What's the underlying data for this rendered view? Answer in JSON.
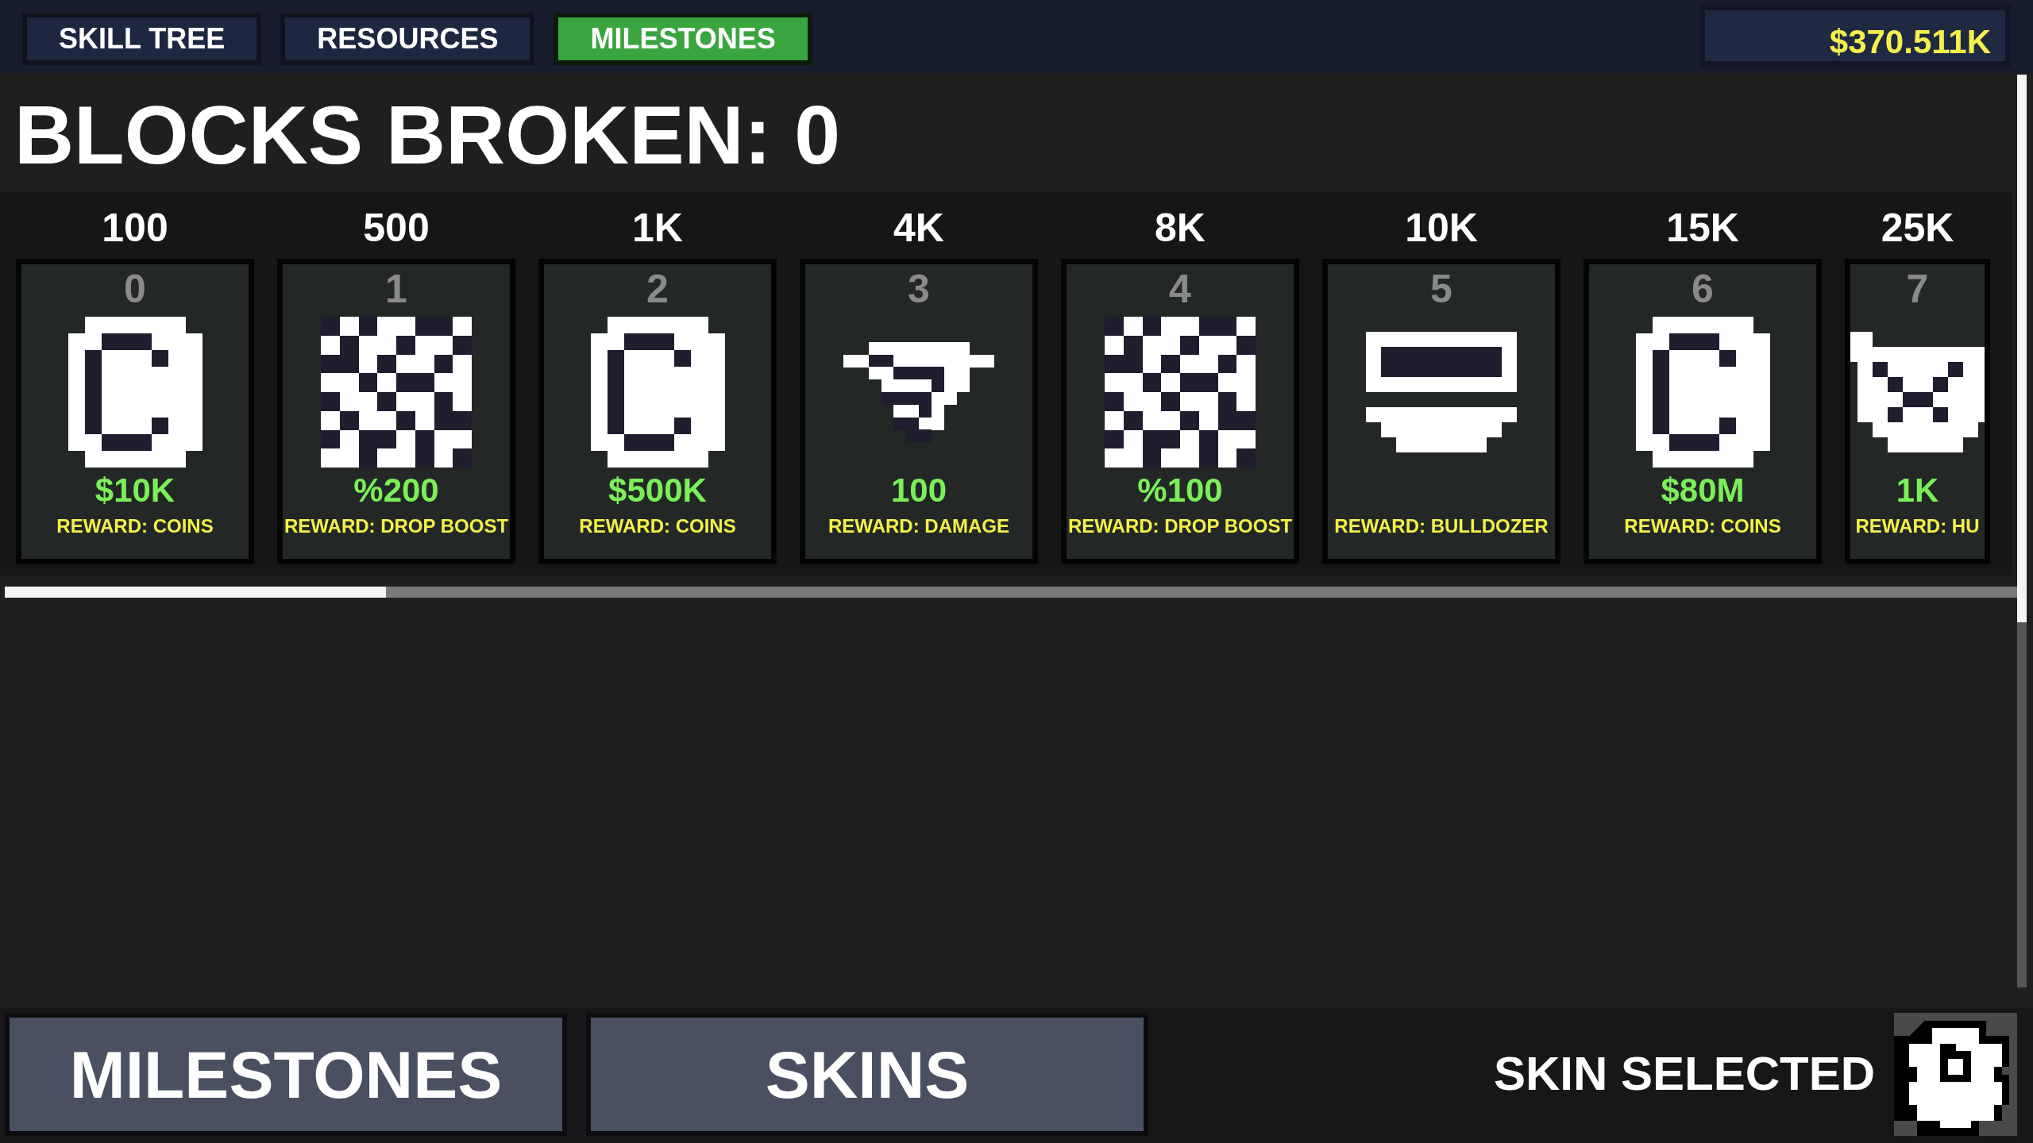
{
  "tabs": [
    {
      "label": "SKILL TREE",
      "selected": false
    },
    {
      "label": "RESOURCES",
      "selected": false
    },
    {
      "label": "MILESTONES",
      "selected": true
    }
  ],
  "balance": "$370.511K",
  "title": "BLOCKS BROKEN: 0",
  "milestones": [
    {
      "threshold": "100",
      "index": "0",
      "kind": "coin",
      "value": "$10K",
      "reward": "REWARD: COINS"
    },
    {
      "threshold": "500",
      "index": "1",
      "kind": "gem",
      "value": "%200",
      "reward": "REWARD: DROP BOOST"
    },
    {
      "threshold": "1K",
      "index": "2",
      "kind": "coin",
      "value": "$500K",
      "reward": "REWARD: COINS"
    },
    {
      "threshold": "4K",
      "index": "3",
      "kind": "tornado",
      "value": "100",
      "reward": "REWARD: DAMAGE"
    },
    {
      "threshold": "8K",
      "index": "4",
      "kind": "gem",
      "value": "%100",
      "reward": "REWARD: DROP BOOST"
    },
    {
      "threshold": "10K",
      "index": "5",
      "kind": "bulldozer",
      "reward": "REWARD: BULLDOZER"
    },
    {
      "threshold": "15K",
      "index": "6",
      "kind": "coin",
      "value": "$80M",
      "reward": "REWARD: COINS"
    },
    {
      "threshold": "25K",
      "index": "7",
      "kind": "cup",
      "value": "1K",
      "reward": "REWARD: HU"
    }
  ],
  "bottom_buttons": [
    "MILESTONES",
    "SKINS"
  ],
  "skin_label": "SKIN SELECTED"
}
